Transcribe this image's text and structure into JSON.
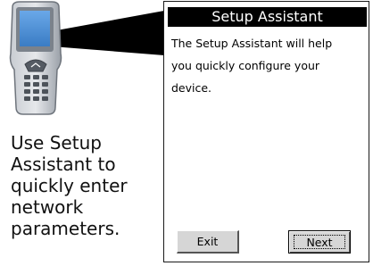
{
  "caption": "Use Setup\nAssistant to\nquickly enter\nnetwork\nparameters.",
  "device": {
    "icon": "handheld-computer-icon"
  },
  "dialog": {
    "title": "Setup Assistant",
    "body": "The Setup Assistant will help\nyou quickly configure your\ndevice.",
    "buttons": {
      "exit_label": "Exit",
      "next_label": "Next"
    }
  },
  "colors": {
    "device_body": "#b9bfc6",
    "device_screen": "#4a8fd6",
    "title_bar": "#000000",
    "button_face": "#d6d6d6"
  }
}
